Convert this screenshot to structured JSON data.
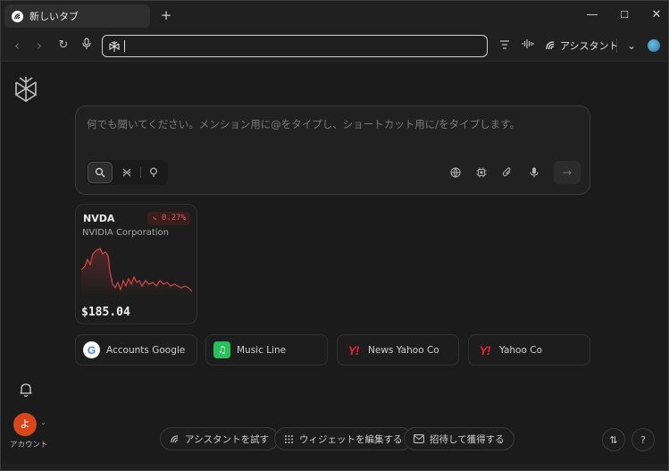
{
  "tab": {
    "title": "新しいタブ",
    "new_tab_label": "+"
  },
  "window_controls": {
    "minimize": "—",
    "maximize": "☐",
    "close": "✕"
  },
  "toolbar": {
    "back": "‹",
    "forward": "›",
    "reload": "↻",
    "address_value": "",
    "assistant_label": "アシスタント",
    "menu_chevron": "⌄"
  },
  "search": {
    "placeholder": "何でも聞いてください。メンション用に@をタイプし、ショートカット用に/をタイプします。",
    "submit_icon": "→"
  },
  "stock": {
    "ticker": "NVDA",
    "company": "NVIDIA Corporation",
    "change": "↘ 0.27%",
    "price": "$185.04",
    "color": "#d64545"
  },
  "shortcuts": [
    {
      "label": "Accounts Google",
      "icon": "google-icon",
      "glyph": "G"
    },
    {
      "label": "Music Line",
      "icon": "music-line-icon",
      "glyph": "♫"
    },
    {
      "label": "News Yahoo Co",
      "icon": "yahoo-icon",
      "glyph": "Y!"
    },
    {
      "label": "Yahoo Co",
      "icon": "yahoo-icon",
      "glyph": "Y!"
    }
  ],
  "sidebar": {
    "avatar_initial": "よ",
    "account_label": "アカウント"
  },
  "bottom": {
    "try_assistant": "アシスタントを試す",
    "edit_widgets": "ウィジェットを編集する",
    "invite": "招待して獲得する",
    "translate_icon": "⇅",
    "help": "?"
  },
  "colors": {
    "accent_green": "#26c15a",
    "yahoo_red": "#e0253a",
    "avatar": "#d8471c"
  }
}
